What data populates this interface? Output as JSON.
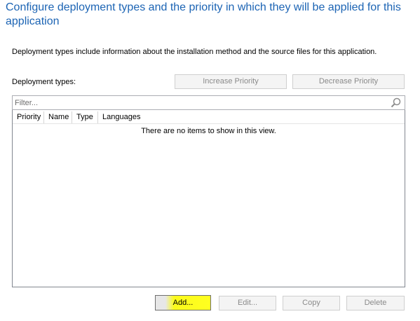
{
  "header": {
    "title": "Configure deployment types and the priority in which they will be applied for this application"
  },
  "description": "Deployment types include information about the installation method and the source files for this application.",
  "deployment_types": {
    "label": "Deployment types:",
    "increase_priority": "Increase Priority",
    "decrease_priority": "Decrease Priority",
    "filter_placeholder": "Filter...",
    "columns": [
      "Priority",
      "Name",
      "Type",
      "Languages"
    ],
    "empty_message": "There are no items to show in this view."
  },
  "actions": {
    "add": "Add...",
    "edit": "Edit...",
    "copy": "Copy",
    "delete": "Delete"
  },
  "colors": {
    "title": "#1c64b4",
    "highlight": "#ffff20"
  }
}
